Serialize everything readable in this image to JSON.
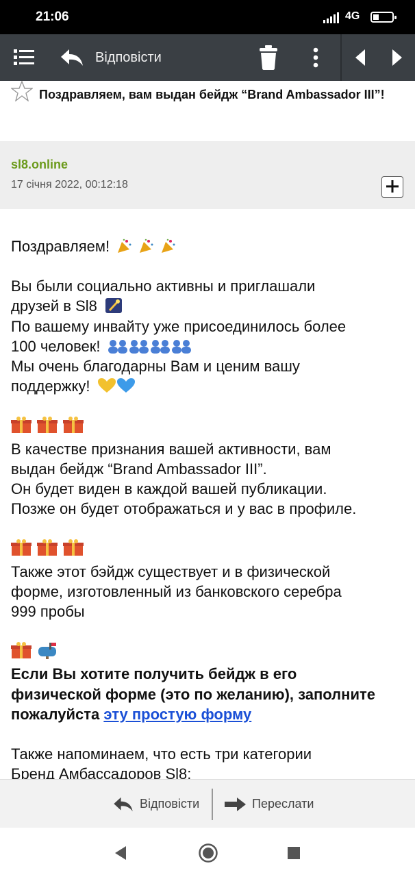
{
  "status": {
    "time": "21:06",
    "network": "4G"
  },
  "toolbar": {
    "reply_label": "Відповісти"
  },
  "subject": {
    "text": "Поздравляем, вам выдан бейдж “Brand Ambassador III”!"
  },
  "sender": {
    "name": "sl8.online",
    "date": "17 січня 2022, 00:12:18"
  },
  "message": {
    "greeting": "Поздравляем!",
    "p1_l1": "Вы были социально активны и приглашали",
    "p1_l2": "друзей в Sl8",
    "p1_l3": "По вашему инвайту уже присоединилось более",
    "p1_l4": "100 человек!",
    "p1_l5": "Мы очень благодарны Вам и ценим вашу",
    "p1_l6": "поддержку!",
    "p2_l1": "В качестве признания вашей активности, вам",
    "p2_l2": "выдан бейдж “Brand Ambassador III”.",
    "p2_l3": "Он будет виден в каждой вашей публикации.",
    "p2_l4": "Позже он будет отображаться и у вас в профиле.",
    "p3_l1": "Также этот бэйдж существует и в физической",
    "p3_l2": "форме, изготовленный из банковского серебра",
    "p3_l3": "999 пробы",
    "p4_l1": "Если Вы хотите получить бейдж в его",
    "p4_l2": "физической форме (это по желанию), заполните",
    "p4_l3": "пожалуйста",
    "p4_link": "эту простую форму",
    "p5_l1": "Также напоминаем, что есть три категории",
    "p5_l2": "Бренд Амбассадоров Sl8:"
  },
  "actions": {
    "reply": "Відповісти",
    "forward": "Переслати"
  },
  "colors": {
    "toolbar": "#3a3f44",
    "sender_name": "#6b9a1b",
    "link": "#1a4fd6"
  }
}
